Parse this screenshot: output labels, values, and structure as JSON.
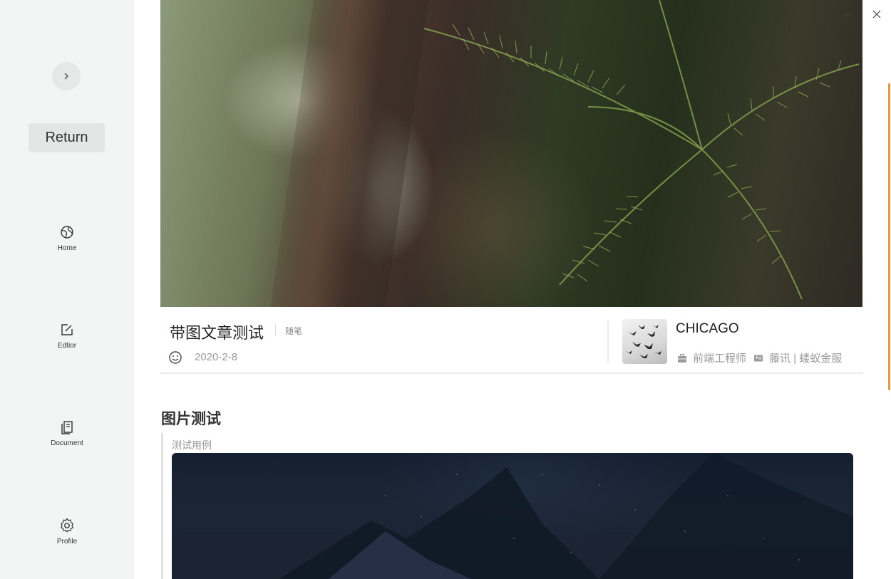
{
  "sidebar": {
    "expand_icon": "chevron-right-icon",
    "return_label": "Return",
    "items": [
      {
        "label": "Home",
        "icon": "globe-icon"
      },
      {
        "label": "Edtior",
        "icon": "edit-icon"
      },
      {
        "label": "Document",
        "icon": "document-icon"
      },
      {
        "label": "Profile",
        "icon": "gear-icon"
      }
    ]
  },
  "window": {
    "minimize_icon": "minimize-icon",
    "close_icon": "close-icon"
  },
  "article": {
    "title": "带图文章测试",
    "tag": "随笔",
    "date": "2020-2-8"
  },
  "author": {
    "name": "CHICAGO",
    "job": "前端工程师",
    "company": "藤讯 | 蝼蚁金服"
  },
  "content": {
    "heading": "图片测试",
    "caption": "测试用例"
  },
  "colors": {
    "sidebar_bg": "#f3f4f4",
    "accent_scrollbar": "#e89a3c",
    "muted_text": "#9a9a9a"
  }
}
